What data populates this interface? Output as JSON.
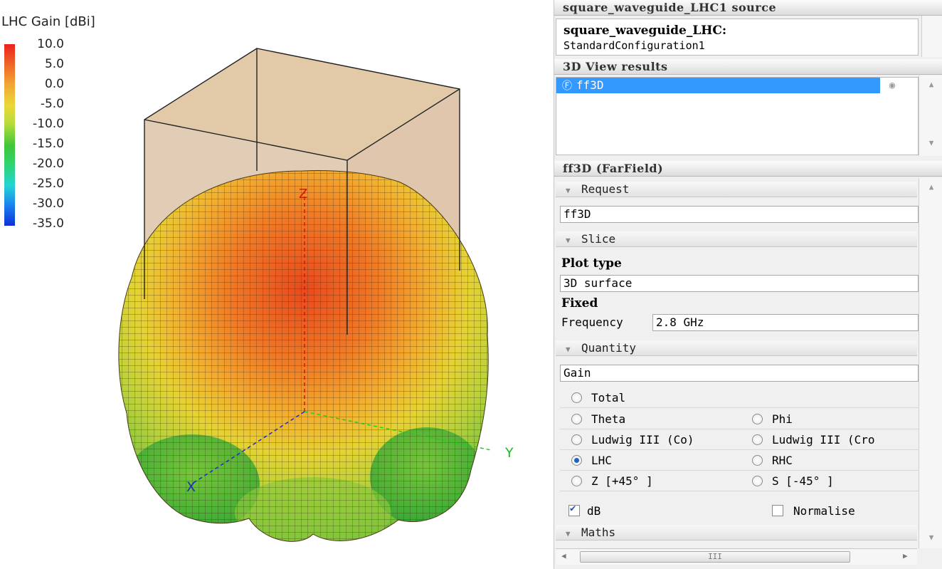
{
  "viewport": {
    "legend": {
      "title": "LHC Gain [dBi]",
      "ticks": [
        "10.0",
        "5.0",
        "0.0",
        "-5.0",
        "-10.0",
        "-15.0",
        "-20.0",
        "-25.0",
        "-30.0",
        "-35.0"
      ]
    },
    "axes": {
      "x": "X",
      "y": "Y",
      "z": "Z"
    }
  },
  "panel": {
    "source_header": "square_waveguide_LHC1 source",
    "source_name": "square_waveguide_LHC:",
    "source_config": "StandardConfiguration1",
    "results_header": "3D View results",
    "result_item": "ff3D",
    "result_icons": {
      "item": "farfield-icon",
      "visibility": "eye-icon"
    },
    "props_header": "ff3D (FarField)",
    "request": {
      "label": "Request",
      "value": "ff3D"
    },
    "slice": {
      "label": "Slice",
      "plot_type_label": "Plot type",
      "plot_type_value": "3D surface",
      "fixed_label": "Fixed",
      "frequency_label": "Frequency",
      "frequency_value": "2.8 GHz"
    },
    "quantity": {
      "label": "Quantity",
      "value": "Gain",
      "options": {
        "total": "Total",
        "theta": "Theta",
        "phi": "Phi",
        "ludwig_co": "Ludwig III (Co)",
        "ludwig_cr": "Ludwig III (Cro",
        "lhc": "LHC",
        "rhc": "RHC",
        "z45": "Z [+45° ]",
        "s45": "S [-45° ]"
      },
      "selected": "LHC",
      "db_label": "dB",
      "db_checked": true,
      "normalise_label": "Normalise",
      "normalise_checked": false
    },
    "maths": {
      "label": "Maths"
    },
    "hscroll_grip": "III"
  }
}
